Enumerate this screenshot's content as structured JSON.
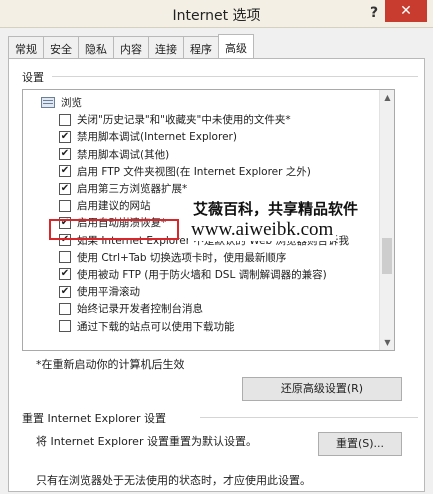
{
  "window": {
    "title": "Internet 选项",
    "help": "?",
    "close": "✕"
  },
  "tabs": [
    "常规",
    "安全",
    "隐私",
    "内容",
    "连接",
    "程序",
    "高级"
  ],
  "settings_group": {
    "label": "设置"
  },
  "list": {
    "category": "浏览",
    "items": [
      {
        "label": "关闭\"历史记录\"和\"收藏夹\"中未使用的文件夹*",
        "checked": false
      },
      {
        "label": "禁用脚本调试(Internet Explorer)",
        "checked": true
      },
      {
        "label": "禁用脚本调试(其他)",
        "checked": true
      },
      {
        "label": "启用 FTP 文件夹视图(在 Internet Explorer 之外)",
        "checked": true
      },
      {
        "label": "启用第三方浏览器扩展*",
        "checked": true
      },
      {
        "label": "启用建议的网站",
        "checked": false
      },
      {
        "label": "启用自动崩溃恢复*",
        "checked": true
      },
      {
        "label": "如果 Internet Explorer 不是默认的 Web 浏览器则告诉我",
        "checked": true
      },
      {
        "label": "使用 Ctrl+Tab 切换选项卡时，使用最新顺序",
        "checked": false
      },
      {
        "label": "使用被动 FTP (用于防火墙和 DSL 调制解调器的兼容)",
        "checked": true
      },
      {
        "label": "使用平滑滚动",
        "checked": true
      },
      {
        "label": "始终记录开发者控制台消息",
        "checked": false
      },
      {
        "label": "通过下载的站点可以使用下载功能",
        "checked": false
      }
    ]
  },
  "watermark": {
    "line1": "艾薇百科，共享精品软件",
    "line2": "www.aiweibk.com"
  },
  "restart_note": "*在重新启动你的计算机后生效",
  "restore_button": "还原高级设置(R)",
  "reset_group": {
    "label": "重置 Internet Explorer 设置",
    "description": "将 Internet Explorer 设置重置为默认设置。",
    "button": "重置(S)...",
    "footer": "只有在浏览器处于无法使用的状态时，才应使用此设置。"
  },
  "scrollbar": {
    "up": "▲",
    "down": "▼"
  }
}
